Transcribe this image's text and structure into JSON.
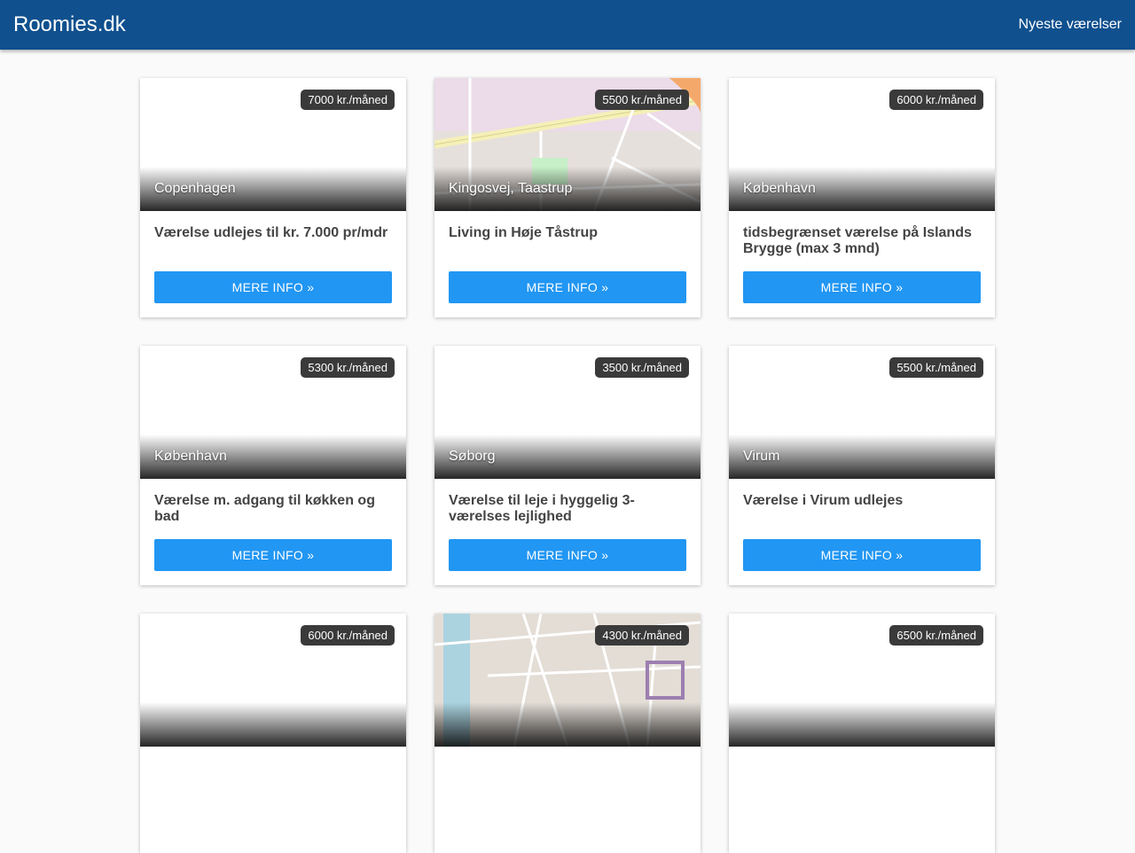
{
  "header": {
    "brand": "Roomies.dk",
    "nav_link": "Nyeste værelser"
  },
  "listings": [
    {
      "price": "7000 kr./måned",
      "location": "Copenhagen",
      "title": "Værelse udlejes til kr. 7.000 pr/mdr",
      "button": "MERE INFO »",
      "image": "none"
    },
    {
      "price": "5500 kr./måned",
      "location": "Kingosvej, Taastrup",
      "title": "Living in Høje Tåstrup",
      "button": "MERE INFO »",
      "image": "map"
    },
    {
      "price": "6000 kr./måned",
      "location": "København",
      "title": "tidsbegrænset værelse på Islands Brygge (max 3 mnd)",
      "button": "MERE INFO »",
      "image": "none"
    },
    {
      "price": "5300 kr./måned",
      "location": "København",
      "title": "Værelse m. adgang til køkken og bad",
      "button": "MERE INFO »",
      "image": "none"
    },
    {
      "price": "3500 kr./måned",
      "location": "Søborg",
      "title": "Værelse til leje i hyggelig 3-værelses lejlighed",
      "button": "MERE INFO »",
      "image": "none"
    },
    {
      "price": "5500 kr./måned",
      "location": "Virum",
      "title": "Værelse i Virum udlejes",
      "button": "MERE INFO »",
      "image": "none"
    },
    {
      "price": "6000 kr./måned",
      "location": "",
      "title": "",
      "button": "",
      "image": "none"
    },
    {
      "price": "4300 kr./måned",
      "location": "",
      "title": "",
      "button": "",
      "image": "map"
    },
    {
      "price": "6500 kr./måned",
      "location": "",
      "title": "",
      "button": "",
      "image": "none"
    }
  ]
}
